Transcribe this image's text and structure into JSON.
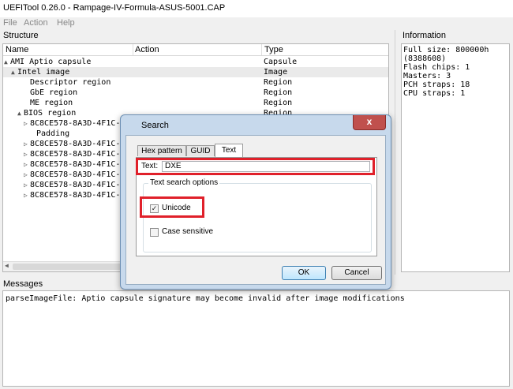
{
  "window": {
    "title": "UEFITool 0.26.0 - Rampage-IV-Formula-ASUS-5001.CAP"
  },
  "menu": [
    "File",
    "Action",
    "Help"
  ],
  "structure": {
    "label": "Structure",
    "columns": [
      "Name",
      "Action",
      "Type"
    ],
    "rows": [
      {
        "arrow": "▲",
        "name": "AMI Aptio capsule",
        "type": "Capsule"
      },
      {
        "arrow": "▲",
        "name": "Intel image",
        "type": "Image"
      },
      {
        "arrow": "",
        "name": "Descriptor region",
        "type": "Region"
      },
      {
        "arrow": "",
        "name": "GbE region",
        "type": "Region"
      },
      {
        "arrow": "",
        "name": "ME region",
        "type": "Region"
      },
      {
        "arrow": "▲",
        "name": "BIOS region",
        "type": "Region"
      },
      {
        "arrow": "▷",
        "name": "8C8CE578-8A3D-4F1C-9…",
        "type": ""
      },
      {
        "arrow": "",
        "name": "Padding",
        "type": ""
      },
      {
        "arrow": "▷",
        "name": "8C8CE578-8A3D-4F1C-9…",
        "type": ""
      },
      {
        "arrow": "▷",
        "name": "8C8CE578-8A3D-4F1C-9…",
        "type": ""
      },
      {
        "arrow": "▷",
        "name": "8C8CE578-8A3D-4F1C-9…",
        "type": ""
      },
      {
        "arrow": "▷",
        "name": "8C8CE578-8A3D-4F1C-9…",
        "type": ""
      },
      {
        "arrow": "▷",
        "name": "8C8CE578-8A3D-4F1C-9…",
        "type": ""
      },
      {
        "arrow": "▷",
        "name": "8C8CE578-8A3D-4F1C-9…",
        "type": ""
      }
    ]
  },
  "information": {
    "label": "Information",
    "lines": [
      "Full size: 800000h",
      "(8388608)",
      "Flash chips: 1",
      "Masters: 3",
      "PCH straps: 18",
      "CPU straps: 1"
    ]
  },
  "messages": {
    "label": "Messages",
    "lines": [
      "parseImageFile: Aptio capsule signature may become invalid after image modifications"
    ]
  },
  "dialog": {
    "title": "Search",
    "close_glyph": "x",
    "tabs": [
      "Hex pattern",
      "GUID",
      "Text"
    ],
    "active_tab": "Text",
    "text_label": "Text:",
    "text_value": "DXE",
    "group_label": "Text search options",
    "unicode_label": "Unicode",
    "unicode_checked": true,
    "case_label": "Case sensitive",
    "case_checked": false,
    "ok_label": "OK",
    "cancel_label": "Cancel"
  },
  "colors": {
    "highlight": "#e0202a",
    "dialog_frame": "#c7d9ec"
  }
}
